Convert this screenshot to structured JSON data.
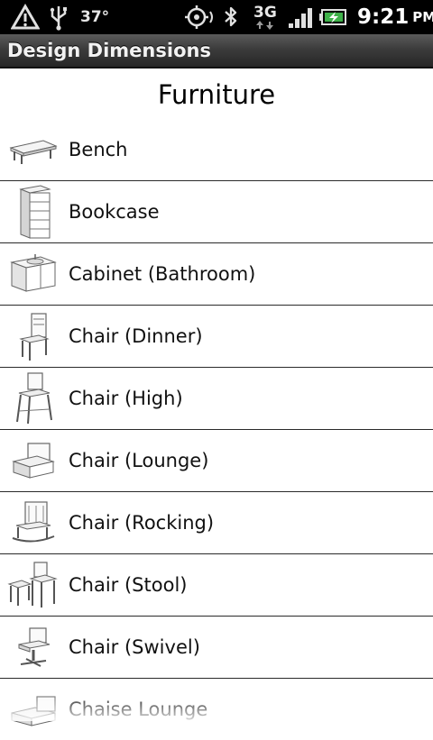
{
  "status_bar": {
    "temperature": "37°",
    "network": "3G",
    "time": "9:21",
    "ampm": "PM",
    "icons": [
      "warning-icon",
      "usb-icon",
      "gps-icon",
      "bluetooth-icon",
      "network-3g-icon",
      "signal-icon",
      "battery-charging-icon"
    ]
  },
  "app": {
    "title": "Design Dimensions"
  },
  "page": {
    "heading": "Furniture"
  },
  "furniture": [
    {
      "label": "Bench",
      "icon": "bench-icon"
    },
    {
      "label": "Bookcase",
      "icon": "bookcase-icon"
    },
    {
      "label": "Cabinet (Bathroom)",
      "icon": "cabinet-icon"
    },
    {
      "label": "Chair (Dinner)",
      "icon": "dinner-chair-icon"
    },
    {
      "label": "Chair (High)",
      "icon": "high-chair-icon"
    },
    {
      "label": "Chair (Lounge)",
      "icon": "lounge-chair-icon"
    },
    {
      "label": "Chair (Rocking)",
      "icon": "rocking-chair-icon"
    },
    {
      "label": "Chair (Stool)",
      "icon": "stool-icon"
    },
    {
      "label": "Chair (Swivel)",
      "icon": "swivel-chair-icon"
    },
    {
      "label": "Chaise Lounge",
      "icon": "chaise-lounge-icon"
    }
  ]
}
